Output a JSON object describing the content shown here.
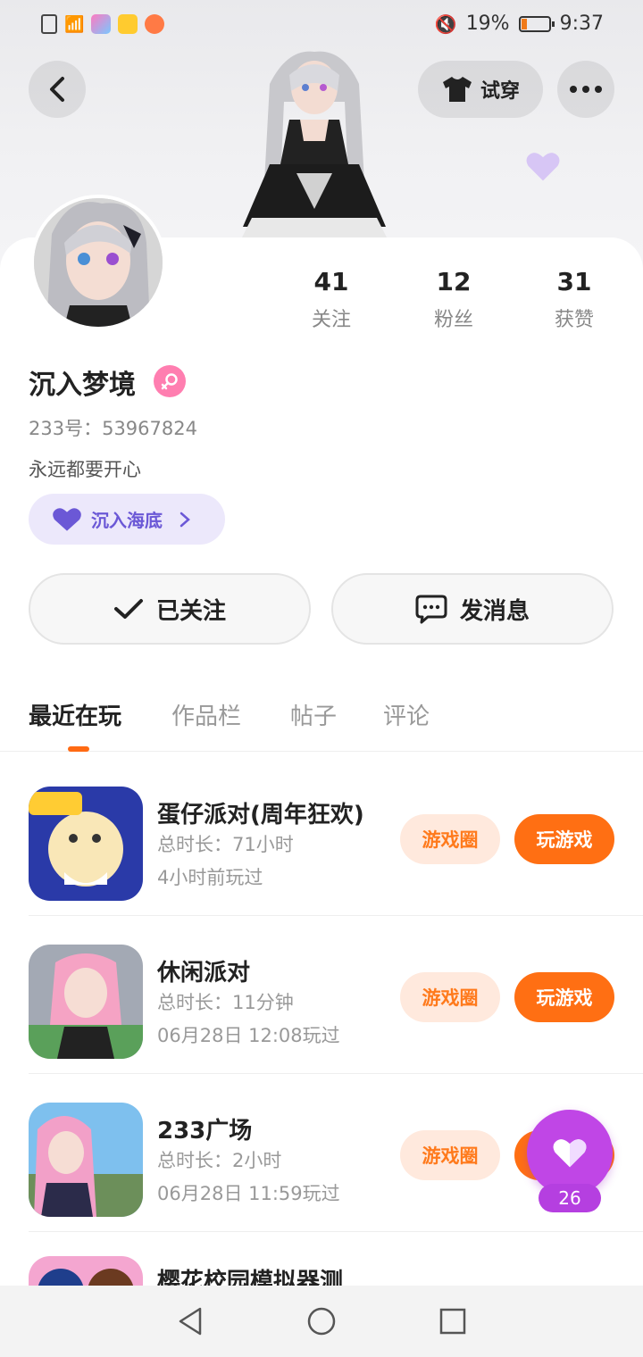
{
  "statusbar": {
    "battery": "19%",
    "time": "9:37"
  },
  "header": {
    "tryon_label": "试穿"
  },
  "profile": {
    "stats": [
      {
        "num": "41",
        "label": "关注"
      },
      {
        "num": "12",
        "label": "粉丝"
      },
      {
        "num": "31",
        "label": "获赞"
      }
    ],
    "username": "沉入梦境",
    "uid": "233号：53967824",
    "bio": "永远都要开心",
    "guild": "沉入海底"
  },
  "actions": {
    "follow_label": "已关注",
    "message_label": "发消息"
  },
  "tabs": [
    {
      "label": "最近在玩"
    },
    {
      "label": "作品栏"
    },
    {
      "label": "帖子"
    },
    {
      "label": "评论"
    }
  ],
  "games": [
    {
      "title": "蛋仔派对(周年狂欢)",
      "duration": "总时长：71小时",
      "last": "4小时前玩过",
      "circle": "游戏圈",
      "play": "玩游戏"
    },
    {
      "title": "休闲派对",
      "duration": "总时长：11分钟",
      "last": "06月28日 12:08玩过",
      "circle": "游戏圈",
      "play": "玩游戏"
    },
    {
      "title": "233广场",
      "duration": "总时长：2小时",
      "last": "06月28日 11:59玩过",
      "circle": "游戏圈",
      "play": "玩游戏"
    },
    {
      "title": "樱花校园模拟器测"
    }
  ],
  "fab": {
    "count": "26"
  },
  "colors": {
    "accent": "#ff6f13",
    "fab": "#c046e6",
    "guild": "#6b58d6"
  }
}
